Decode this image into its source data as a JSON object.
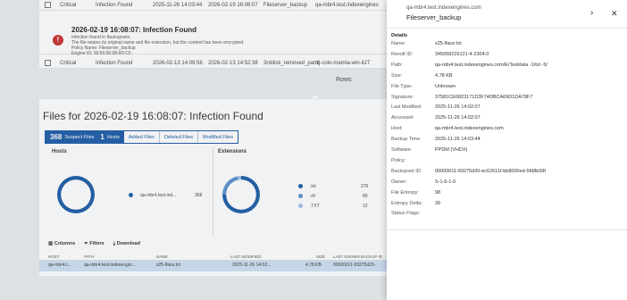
{
  "alerts": {
    "top_row": {
      "severity": "Critical",
      "type": "Infection Found",
      "date1": "2025-11-26 14:03:44",
      "date2": "2026-02-19 16:08:07",
      "policy": "Fileserver_backup",
      "host": "qa-mbr4.test.indexengines"
    },
    "expanded": {
      "title": "2026-02-19 16:08:07: Infection Found",
      "lines": [
        "Infection found in Backupsets.",
        "The file retains its original name and file extension, but the content has been encrypted.",
        "Policy Name: Fileserver_backup",
        "Engine ID: 00:50:56:98:8D:C5"
      ]
    },
    "second_row": {
      "severity": "Critical",
      "type": "Infection Found",
      "date1": "2026-02-13 14:09:56",
      "date2": "2026-02-13 14:52:38",
      "policy": "3rddisk_removed_partit",
      "host": "rrj-colo-mamta-win-it27"
    },
    "rows_label": "Rows"
  },
  "files": {
    "title": "Files for 2026-02-19 16:08:07: Infection Found",
    "tabs": [
      {
        "count": "368",
        "label": "Suspect Files"
      },
      {
        "count": "1",
        "label": "Hosts"
      },
      {
        "label": "Added Files"
      },
      {
        "label": "Deleted Files"
      },
      {
        "label": "Modified Files"
      }
    ],
    "hosts_panel": {
      "title": "Hosts",
      "legend": [
        {
          "name": "qa-mbr4.test.ind...",
          "count": "368",
          "color": "#1b5ba6"
        }
      ]
    },
    "ext_panel": {
      "title": "Extensions",
      "legend": [
        {
          "name": ".txt",
          "count": "276",
          "color": "#1b5ba6"
        },
        {
          "name": ".rtf",
          "count": "80",
          "color": "#5b8fd0"
        },
        {
          "name": ".TXT",
          "count": "12",
          "color": "#9fc1e8"
        }
      ]
    },
    "toolbar": {
      "columns": "Columns",
      "filters": "Filters",
      "download": "Download"
    },
    "grid_headers": [
      "HOST",
      "PATH",
      "NAME",
      "LAST MODIFIED",
      "SIZE",
      "LAST KNOWN BACKUP ID"
    ],
    "grid_row": [
      "qa-mbr4.t...",
      "qa-mbr4.test.indexengin...",
      "x25-lface.txt",
      "2025-11-26 14:02...",
      "4.78 KB",
      "00000011-69275d20-"
    ]
  },
  "side": {
    "host": "qa-mbr4.test.indexengines.com",
    "title": "Fileserver_backup",
    "details_label": "Details",
    "fields": [
      {
        "k": "Name:",
        "v": "x25-lface.txt"
      },
      {
        "k": "Result ID:",
        "v": "345058226121-4-2304.0"
      },
      {
        "k": "Path:",
        "v": "qa-mbr4.test.indexengines.com/E/Testdata -1/txt -5/"
      },
      {
        "k": "Size:",
        "v": "4.78 KB"
      },
      {
        "k": "File Type:",
        "v": "Unknown"
      },
      {
        "k": "Signature:",
        "v": "37581CE0823171D3F74DBCA69D1DA78F7"
      },
      {
        "k": "Last Modified:",
        "v": "2025-11-26 14:02:07"
      },
      {
        "k": "Accessed:",
        "v": "2025-11-26 14:02:07"
      },
      {
        "k": "Host:",
        "v": "qa-mbr4.test.indexengines.com"
      },
      {
        "k": "Backup Time:",
        "v": "2025-11-26 14:03:44"
      },
      {
        "k": "Software:",
        "v": "PPDM (VHDX)"
      },
      {
        "k": "Policy:",
        "v": ""
      },
      {
        "k": "Backupset ID:",
        "v": "00000011-69275d20-ec62611f-bb8000ed-5fd8b99f"
      },
      {
        "k": "Owner:",
        "v": "S-1-6-1-0"
      },
      {
        "k": "File Entropy:",
        "v": "98"
      },
      {
        "k": "Entropy Delta:",
        "v": "39"
      },
      {
        "k": "Status Flags:",
        "v": ""
      }
    ],
    "chevron": "›",
    "close": "✕"
  }
}
